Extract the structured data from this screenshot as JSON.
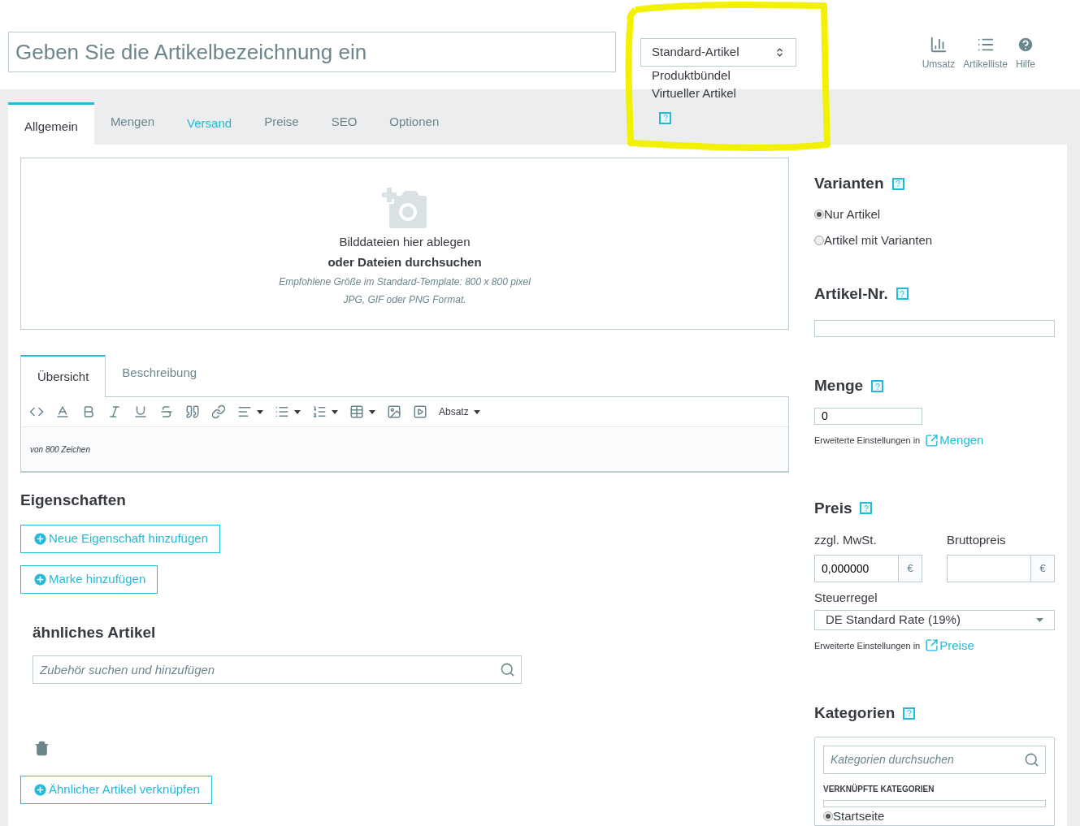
{
  "header": {
    "title_placeholder": "Geben Sie die Artikelbezeichnung ein",
    "product_type": {
      "value": "Standard-Artikel",
      "options": [
        "Produktbündel",
        "Virtueller Artikel"
      ]
    },
    "nav_items": [
      {
        "kind": "chart",
        "label": "Umsatz"
      },
      {
        "kind": "list",
        "label": "Artikelliste"
      },
      {
        "kind": "help",
        "label": "Hilfe"
      }
    ]
  },
  "tabs": [
    {
      "label": "Allgemein",
      "selected": true,
      "highlighted": false
    },
    {
      "label": "Mengen",
      "selected": false,
      "highlighted": false
    },
    {
      "label": "Versand",
      "selected": false,
      "highlighted": true
    },
    {
      "label": "Preise",
      "selected": false,
      "highlighted": false
    },
    {
      "label": "SEO",
      "selected": false,
      "highlighted": false
    },
    {
      "label": "Optionen",
      "selected": false,
      "highlighted": false
    }
  ],
  "dropzone": {
    "text": "Bilddateien hier ablegen",
    "link": "oder Dateien durchsuchen",
    "hint": "Empfohlene Größe im Standard-Template: 800 x 800 pixel",
    "formats": "JPG, GIF oder PNG Format."
  },
  "editor": {
    "tabs": [
      {
        "label": "Übersicht",
        "selected": true
      },
      {
        "label": "Beschreibung",
        "selected": false
      }
    ],
    "paragraph": "Absatz",
    "counter": "von 800 Zeichen"
  },
  "properties": {
    "heading": "Eigenschaften",
    "buttons": [
      "Neue Eigenschaft hinzufügen",
      "Marke hinzufügen"
    ]
  },
  "related": {
    "heading": "ähnliches Artikel",
    "search_placeholder": "Zubehör suchen und hinzufügen",
    "add_button": "Ähnlicher Artikel verknüpfen"
  },
  "variants": {
    "heading": "Varianten",
    "options": [
      {
        "label": "Nur Artikel",
        "selected": true
      },
      {
        "label": "Artikel mit Varianten",
        "selected": false
      }
    ]
  },
  "sku": {
    "heading": "Artikel-Nr."
  },
  "quantity": {
    "heading": "Menge",
    "value": "0",
    "note": "Erweiterte Einstellungen in",
    "link": "Mengen"
  },
  "price": {
    "heading": "Preis",
    "net_label": "zzgl. MwSt.",
    "net_value": "0,000000",
    "net_currency": "€",
    "gross_label": "Bruttopreis",
    "gross_currency": "€",
    "tax_label": "Steuerregel",
    "tax_value": "DE Standard Rate (19%)",
    "note": "Erweiterte Einstellungen in",
    "link": "Preise"
  },
  "categories": {
    "heading": "Kategorien",
    "search_placeholder": "Kategorien durchsuchen",
    "linked_label": "VERKNÜPFTE KATEGORIEN",
    "items": [
      {
        "label": "Startseite",
        "selected": true
      }
    ]
  }
}
